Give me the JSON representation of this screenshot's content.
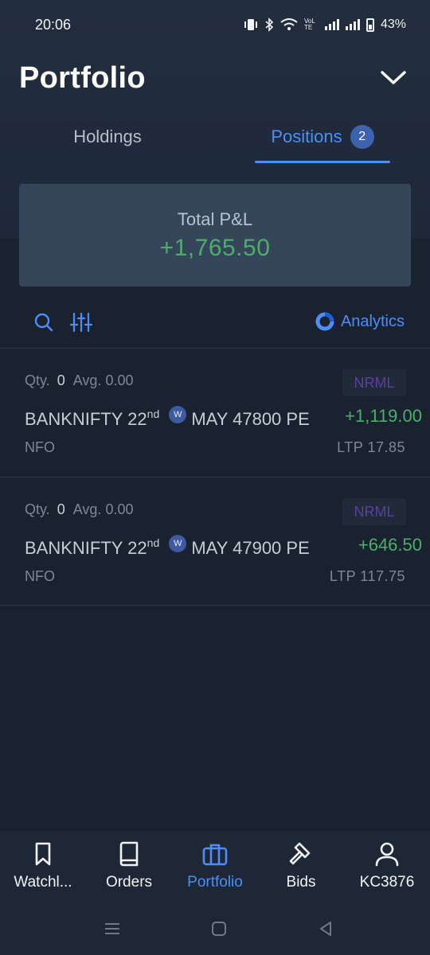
{
  "status_bar": {
    "time": "20:06",
    "battery": "43%",
    "carrier_tag": "VoLTE"
  },
  "header": {
    "title": "Portfolio"
  },
  "tabs": [
    {
      "label": "Holdings",
      "active": false
    },
    {
      "label": "Positions",
      "active": true,
      "badge": "2"
    }
  ],
  "summary": {
    "label": "Total P&L",
    "value": "+1,765.50"
  },
  "toolbar": {
    "analytics_label": "Analytics"
  },
  "positions": [
    {
      "qty_label": "Qty.",
      "qty": "0",
      "avg_label": "Avg.",
      "avg": "0.00",
      "product": "NRML",
      "symbol": "BANKNIFTY 22",
      "suffix": "nd",
      "weekly": "W",
      "rest": "MAY 47800 PE",
      "pnl": "+1,119.00",
      "exchange": "NFO",
      "ltp": "LTP 17.85"
    },
    {
      "qty_label": "Qty.",
      "qty": "0",
      "avg_label": "Avg.",
      "avg": "0.00",
      "product": "NRML",
      "symbol": "BANKNIFTY 22",
      "suffix": "nd",
      "weekly": "W",
      "rest": "MAY 47900 PE",
      "pnl": "+646.50",
      "exchange": "NFO",
      "ltp": "LTP 117.75"
    }
  ],
  "bottom_nav": [
    {
      "label": "Watchl...",
      "icon": "bookmark-icon",
      "active": false
    },
    {
      "label": "Orders",
      "icon": "book-icon",
      "active": false
    },
    {
      "label": "Portfolio",
      "icon": "briefcase-icon",
      "active": true
    },
    {
      "label": "Bids",
      "icon": "gavel-icon",
      "active": false
    },
    {
      "label": "KC3876",
      "icon": "user-icon",
      "active": false
    }
  ],
  "colors": {
    "accent": "#4c8ef5",
    "profit": "#4caf68",
    "background": "#1a2230",
    "card": "#35455a"
  }
}
